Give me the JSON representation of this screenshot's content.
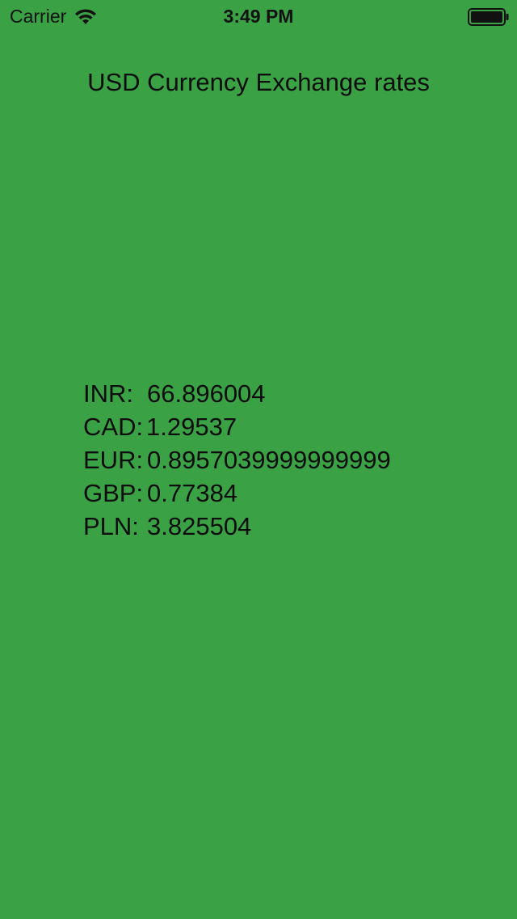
{
  "status_bar": {
    "carrier": "Carrier",
    "time": "3:49 PM",
    "wifi_icon": "wifi-icon",
    "battery_icon": "battery-icon"
  },
  "title": "USD Currency Exchange rates",
  "rates": [
    {
      "code": "INR:",
      "value": "66.896004"
    },
    {
      "code": "CAD:",
      "value": "1.29537"
    },
    {
      "code": "EUR:",
      "value": "0.8957039999999999"
    },
    {
      "code": "GBP:",
      "value": "0.77384"
    },
    {
      "code": "PLN:",
      "value": "3.825504"
    }
  ],
  "colors": {
    "background": "#3aa144",
    "text": "#0d0d0d"
  }
}
